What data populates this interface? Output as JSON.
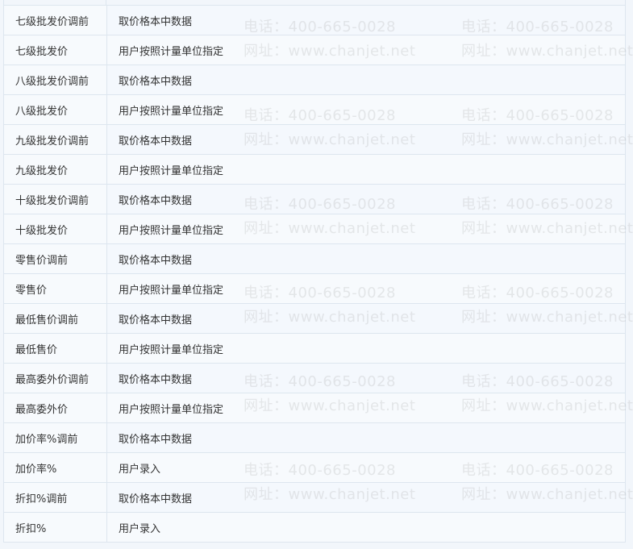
{
  "rows": [
    {
      "name": "七级批发价调前",
      "desc": "取价格本中数据"
    },
    {
      "name": "七级批发价",
      "desc": "用户按照计量单位指定"
    },
    {
      "name": "八级批发价调前",
      "desc": "取价格本中数据"
    },
    {
      "name": "八级批发价",
      "desc": "用户按照计量单位指定"
    },
    {
      "name": "九级批发价调前",
      "desc": "取价格本中数据"
    },
    {
      "name": "九级批发价",
      "desc": "用户按照计量单位指定"
    },
    {
      "name": "十级批发价调前",
      "desc": "取价格本中数据"
    },
    {
      "name": "十级批发价",
      "desc": "用户按照计量单位指定"
    },
    {
      "name": "零售价调前",
      "desc": "取价格本中数据"
    },
    {
      "name": "零售价",
      "desc": "用户按照计量单位指定"
    },
    {
      "name": "最低售价调前",
      "desc": "取价格本中数据"
    },
    {
      "name": "最低售价",
      "desc": "用户按照计量单位指定"
    },
    {
      "name": "最高委外价调前",
      "desc": "取价格本中数据"
    },
    {
      "name": "最高委外价",
      "desc": "用户按照计量单位指定"
    },
    {
      "name": "加价率%调前",
      "desc": "取价格本中数据"
    },
    {
      "name": "加价率%",
      "desc": "用户录入"
    },
    {
      "name": "折扣%调前",
      "desc": "取价格本中数据"
    },
    {
      "name": "折扣%",
      "desc": "用户录入"
    }
  ],
  "watermark": {
    "phone": "电话：400-665-0028",
    "site": "网址：www.chanjet.net"
  }
}
